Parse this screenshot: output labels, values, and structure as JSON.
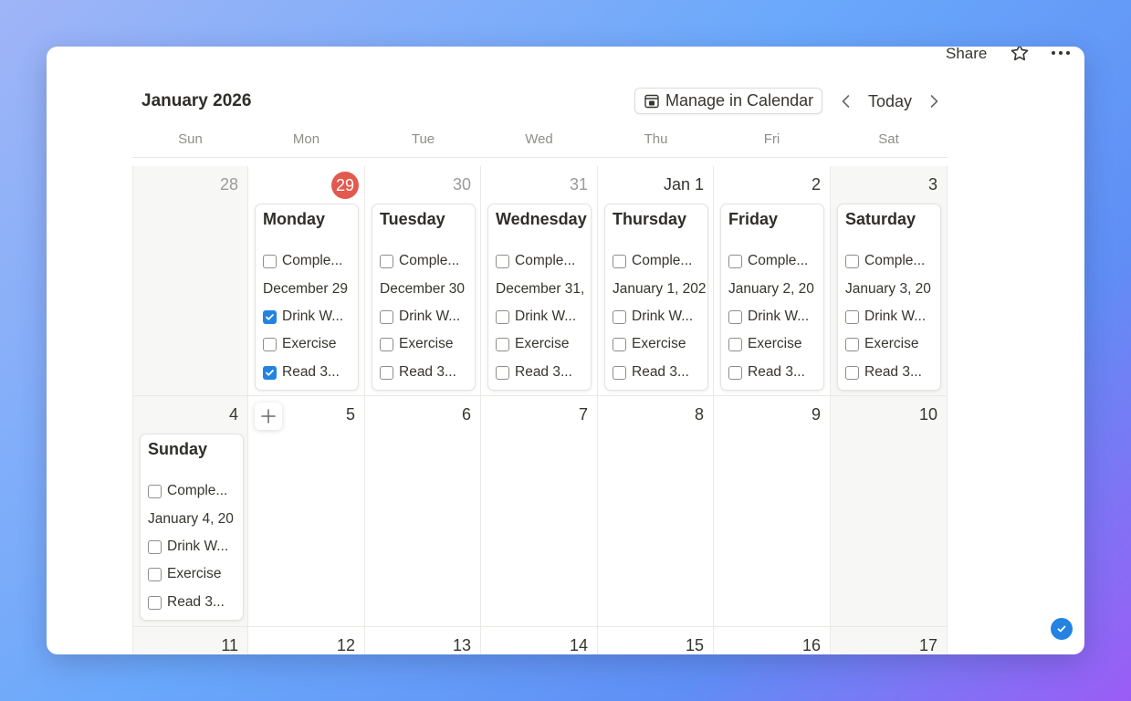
{
  "topbar": {
    "share_label": "Share"
  },
  "calendar": {
    "month_title": "January 2026",
    "manage_label": "Manage in Calendar",
    "today_label": "Today",
    "weekdays": [
      "Sun",
      "Mon",
      "Tue",
      "Wed",
      "Thu",
      "Fri",
      "Sat"
    ],
    "week1": [
      {
        "day": "28",
        "muted": true,
        "weekend": true
      },
      {
        "day": "29",
        "today": true
      },
      {
        "day": "30",
        "muted": true
      },
      {
        "day": "31",
        "muted": true
      },
      {
        "day": "Jan 1"
      },
      {
        "day": "2"
      },
      {
        "day": "3",
        "weekend": true
      }
    ],
    "week2": [
      {
        "day": "4",
        "weekend": true
      },
      {
        "day": "5"
      },
      {
        "day": "6"
      },
      {
        "day": "7"
      },
      {
        "day": "8"
      },
      {
        "day": "9"
      },
      {
        "day": "10",
        "weekend": true
      }
    ],
    "week3": [
      {
        "day": "11",
        "weekend": true
      },
      {
        "day": "12"
      },
      {
        "day": "13"
      },
      {
        "day": "14"
      },
      {
        "day": "15"
      },
      {
        "day": "16"
      },
      {
        "day": "17",
        "weekend": true
      }
    ],
    "cards": {
      "mon": {
        "title": "Monday",
        "complete": "Comple...",
        "date": "December 29",
        "drink": "Drink W...",
        "exercise": "Exercise",
        "read": "Read 3...",
        "drink_checked": true,
        "read_checked": true
      },
      "tue": {
        "title": "Tuesday",
        "complete": "Comple...",
        "date": "December 30",
        "drink": "Drink W...",
        "exercise": "Exercise",
        "read": "Read 3..."
      },
      "wed": {
        "title": "Wednesday",
        "complete": "Comple...",
        "date": "December 31,",
        "drink": "Drink W...",
        "exercise": "Exercise",
        "read": "Read 3..."
      },
      "thu": {
        "title": "Thursday",
        "complete": "Comple...",
        "date": "January 1, 202",
        "drink": "Drink W...",
        "exercise": "Exercise",
        "read": "Read 3..."
      },
      "fri": {
        "title": "Friday",
        "complete": "Comple...",
        "date": "January 2, 20",
        "drink": "Drink W...",
        "exercise": "Exercise",
        "read": "Read 3..."
      },
      "sat": {
        "title": "Saturday",
        "complete": "Comple...",
        "date": "January 3, 20",
        "drink": "Drink W...",
        "exercise": "Exercise",
        "read": "Read 3..."
      },
      "sun": {
        "title": "Sunday",
        "complete": "Comple...",
        "date": "January 4, 20",
        "drink": "Drink W...",
        "exercise": "Exercise",
        "read": "Read 3..."
      }
    }
  },
  "colors": {
    "accent": "#2383e2",
    "today_badge": "#e25a4f"
  }
}
